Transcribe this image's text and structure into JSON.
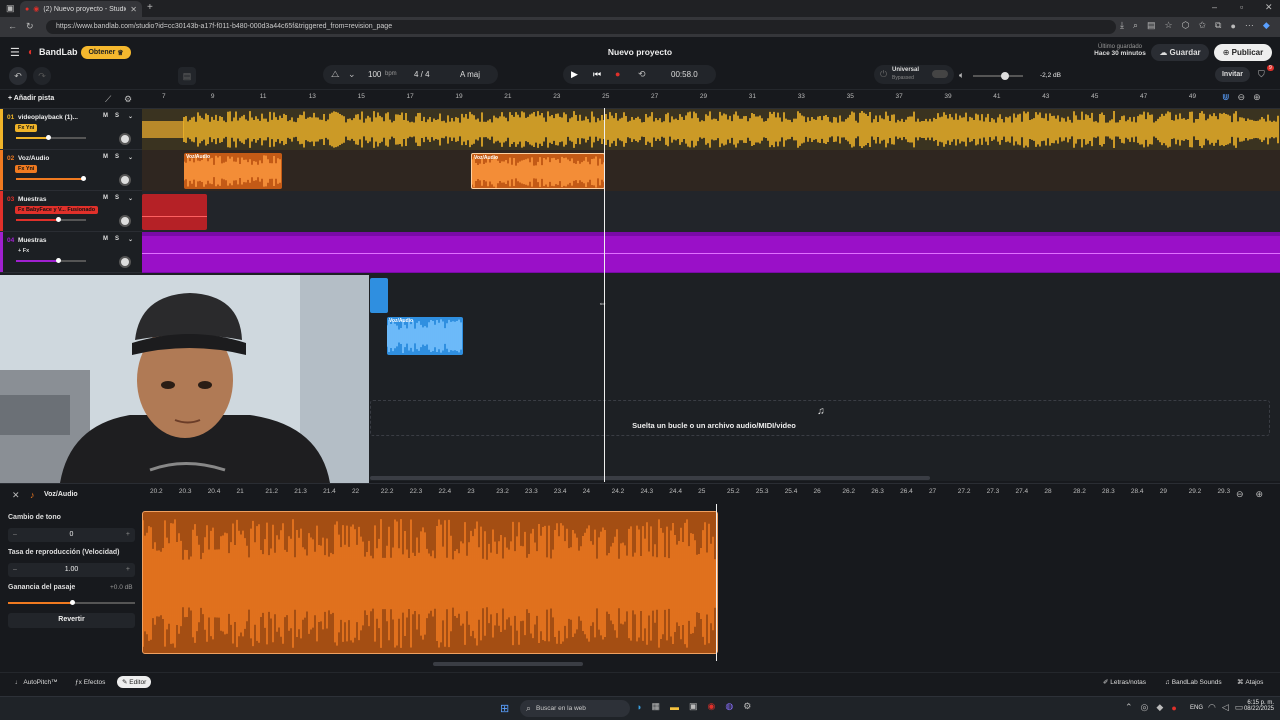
{
  "browser": {
    "tab_title": "(2) Nuevo proyecto - Studio",
    "url": "https://www.bandlab.com/studio?id=cc30143b-a17f-f011-b480-000d3a44c65f&triggered_from=revision_page"
  },
  "app": {
    "logo": "BandLab",
    "upgrade_label": "Obtener",
    "project_title": "Nuevo proyecto",
    "last_saved_label": "Último guardado",
    "last_saved_value": "Hace 30 minutos",
    "save_label": "Guardar",
    "publish_label": "Publicar",
    "invite_label": "Invitar",
    "notification_count": "9"
  },
  "transport": {
    "tempo": "100",
    "tempo_unit": "bpm",
    "time_signature": "4 / 4",
    "key": "A maj",
    "time": "00:58.0",
    "master_label": "Universal",
    "master_sub": "Bypassed",
    "master_volume_db": "-2,2 dB",
    "master_volume_level": 0.45
  },
  "toolbar": {
    "add_track_label": "Añadir pista"
  },
  "ruler_ticks": [
    "7",
    "9",
    "11",
    "13",
    "15",
    "17",
    "19",
    "21",
    "23",
    "25",
    "27",
    "29",
    "31",
    "33",
    "35",
    "37",
    "39",
    "41",
    "43",
    "45",
    "47",
    "49"
  ],
  "tracks": [
    {
      "number": "01",
      "name": "videoplayback (1)...",
      "fx": "Fx Yni",
      "color": "#f0b429",
      "volume_level": 0.45
    },
    {
      "number": "02",
      "name": "Voz/Audio",
      "fx": "Fx Yni",
      "color": "#f07a20",
      "volume_level": 0.95
    },
    {
      "number": "03",
      "name": "Muestras",
      "fx": "Fx BabyFace y V... Fusionado",
      "color": "#e0302a",
      "volume_level": 0.6
    },
    {
      "number": "04",
      "name": "Muestras",
      "fx": "+ Fx",
      "color": "#a020d0",
      "volume_level": 0.6
    }
  ],
  "track_buttons": {
    "mute": "M",
    "solo": "S"
  },
  "clips": {
    "voz_label_1": "Voz/Audio",
    "voz_label_2": "Voz/Audio",
    "blue_label": "Voz/Audio"
  },
  "drop_zone_text": "Suelta un bucle o un archivo audio/MIDI/video",
  "editor": {
    "track_name": "Voz/Audio",
    "pitch_label": "Cambio de tono",
    "pitch_value": "0",
    "rate_label": "Tasa de reproducción (Velocidad)",
    "rate_value": "1.00",
    "gain_label": "Ganancia del pasaje",
    "gain_value": "+0.0 dB",
    "gain_level": 0.5,
    "revert_label": "Revertir",
    "ruler_ticks": [
      "20.2",
      "20.3",
      "20.4",
      "21",
      "21.2",
      "21.3",
      "21.4",
      "22",
      "22.2",
      "22.3",
      "22.4",
      "23",
      "23.2",
      "23.3",
      "23.4",
      "24",
      "24.2",
      "24.3",
      "24.4",
      "25",
      "25.2",
      "25.3",
      "25.4",
      "26",
      "26.2",
      "26.3",
      "26.4",
      "27",
      "27.2",
      "27.3",
      "27.4",
      "28",
      "28.2",
      "28.3",
      "28.4",
      "29",
      "29.2",
      "29.3"
    ]
  },
  "bottom_tabs": {
    "autopitch": "AutoPitch™",
    "effects": "Efectos",
    "editor": "Editor",
    "lyrics": "Letras/notas",
    "sounds": "BandLab Sounds",
    "shortcuts": "Atajos"
  },
  "taskbar": {
    "search_placeholder": "Buscar en la web",
    "language": "ENG",
    "time": "6:15 p. m.",
    "date": "08/22/2025"
  },
  "colors": {
    "yellow": "#f0b429",
    "orange": "#f07a20",
    "red": "#c8282a",
    "purple": "#9a10c8",
    "blue": "#2f8fe0",
    "accent": "#f5b82e"
  }
}
